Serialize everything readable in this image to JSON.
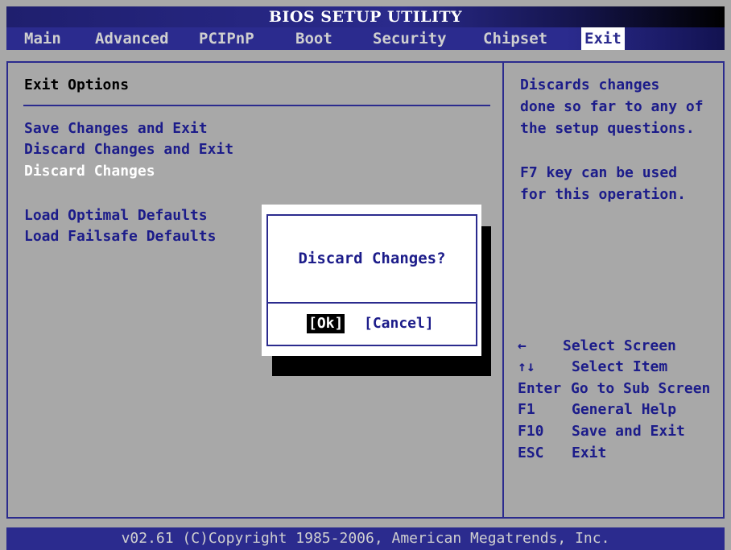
{
  "title": "BIOS SETUP UTILITY",
  "menu": [
    "Main",
    "Advanced",
    "PCIPnP",
    "Boot",
    "Security",
    "Chipset",
    "Exit"
  ],
  "active_menu": "Exit",
  "section_title": "Exit Options",
  "options": {
    "save_exit": "Save Changes and Exit",
    "discard_exit": "Discard Changes and Exit",
    "discard": "Discard Changes",
    "load_optimal": "Load Optimal Defaults",
    "load_failsafe": "Load Failsafe Defaults"
  },
  "help": {
    "line1": "Discards changes",
    "line2": "done so far to any of",
    "line3": "the setup questions.",
    "line4": "F7 key can be used",
    "line5": "for this operation."
  },
  "keys": [
    {
      "key": "←",
      "desc": "Select Screen"
    },
    {
      "key": "↑↓",
      "desc": "Select Item"
    },
    {
      "key": "Enter",
      "desc": "Go to Sub Screen"
    },
    {
      "key": "F1",
      "desc": "General Help"
    },
    {
      "key": "F10",
      "desc": "Save and Exit"
    },
    {
      "key": "ESC",
      "desc": "Exit"
    }
  ],
  "dialog": {
    "question": "Discard Changes?",
    "ok": "[Ok]",
    "cancel": "[Cancel]"
  },
  "footer": "v02.61 (C)Copyright 1985-2006, American Megatrends, Inc."
}
